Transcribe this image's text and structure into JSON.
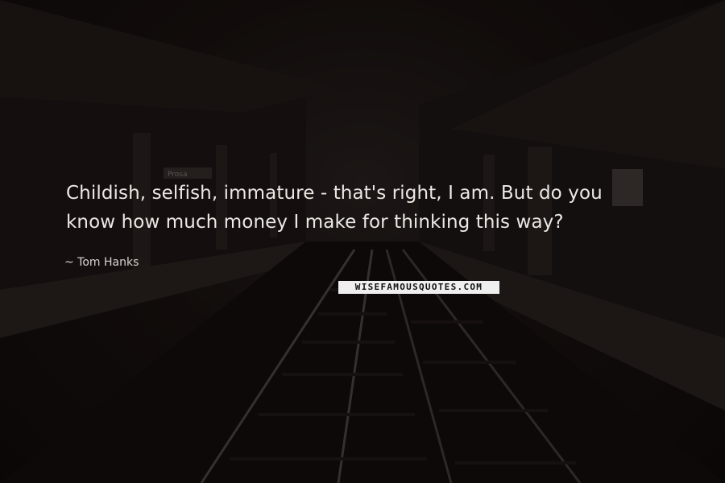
{
  "quote": {
    "line1": "Childish, selfish, immature - that's right, I am. But do you",
    "line2": "know how much money I make for thinking this way?"
  },
  "author": "~ Tom Hanks",
  "watermark": "WISEFAMOUSQUOTES.COM",
  "station_sign": "Prosa",
  "colors": {
    "text": "#ece8e4",
    "background": "#141010"
  }
}
